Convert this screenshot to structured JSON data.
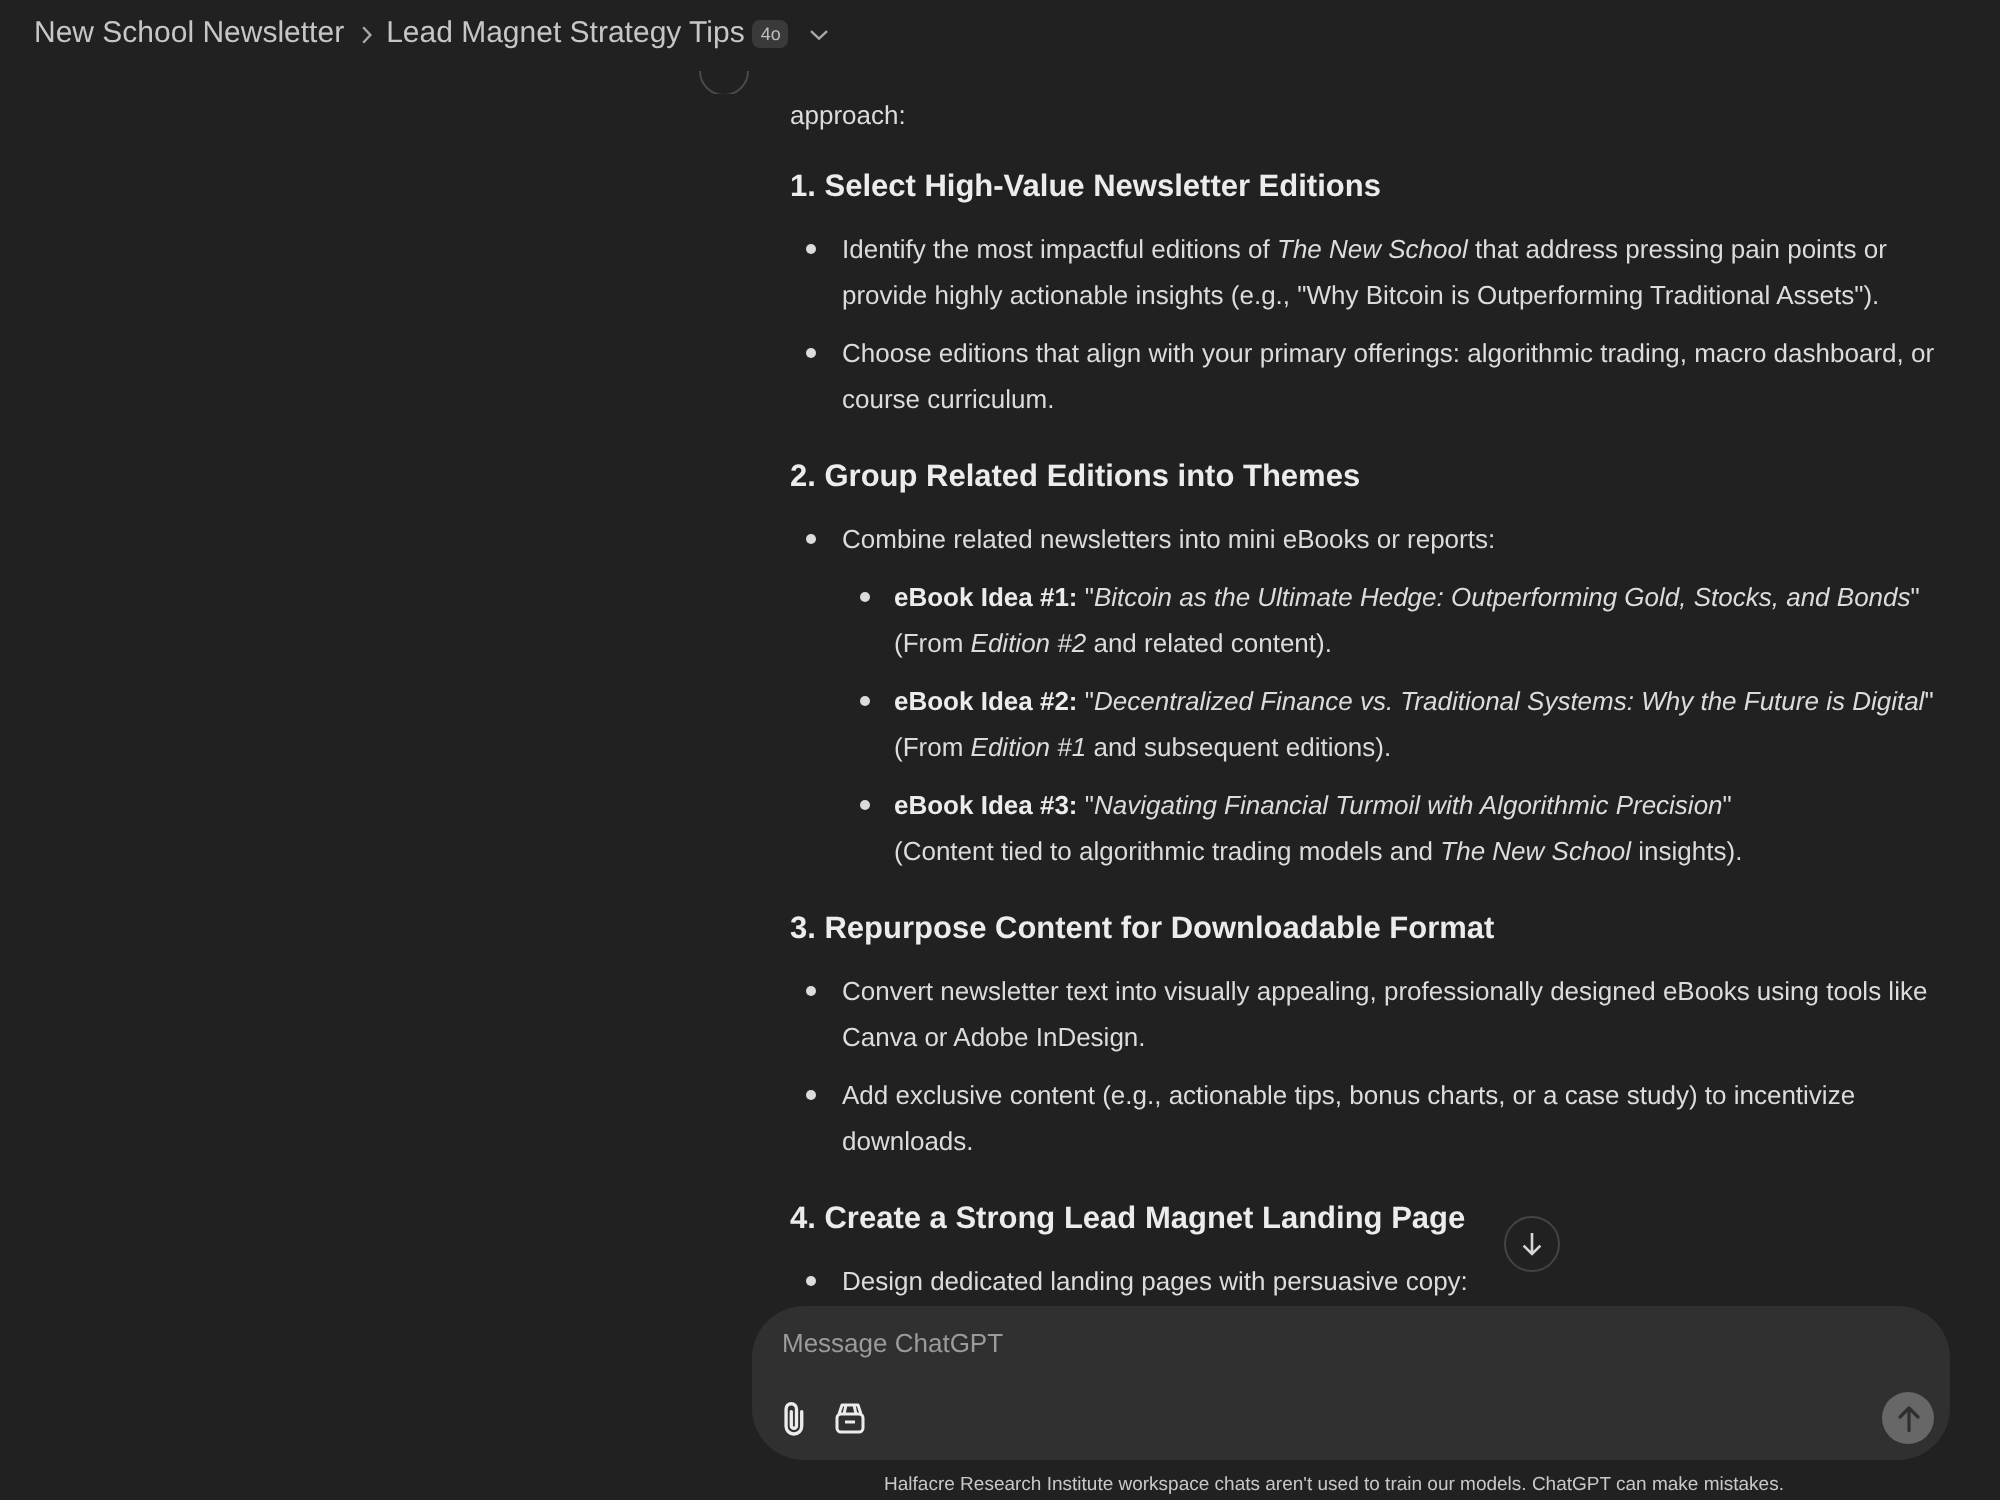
{
  "header": {
    "project": "New School Newsletter",
    "title": "Lead Magnet Strategy Tips",
    "model_badge": "4o"
  },
  "message": {
    "intro": "approach:",
    "sections": [
      {
        "heading": "1. Select High-Value Newsletter Editions",
        "bullets": [
          {
            "text": "Identify the most impactful editions of *The New School* that address pressing pain points or provide highly actionable insights (e.g., \"Why Bitcoin is Outperforming Traditional Assets\")."
          },
          {
            "text": "Choose editions that align with your primary offerings: algorithmic trading, macro dashboard, or course curriculum."
          }
        ]
      },
      {
        "heading": "2. Group Related Editions into Themes",
        "bullets": [
          {
            "text": "Combine related newsletters into mini eBooks or reports:",
            "children": [
              {
                "text": "**eBook Idea #1:** \"*Bitcoin as the Ultimate Hedge: Outperforming Gold, Stocks, and Bonds*\"",
                "note": "(From *Edition #2* and related content)."
              },
              {
                "text": "**eBook Idea #2:** \"*Decentralized Finance vs. Traditional Systems: Why the Future is Digital*\"",
                "note": "(From *Edition #1* and subsequent editions)."
              },
              {
                "text": "**eBook Idea #3:** \"*Navigating Financial Turmoil with Algorithmic Precision*\"",
                "note": "(Content tied to algorithmic trading models and *The New School* insights)."
              }
            ]
          }
        ]
      },
      {
        "heading": "3. Repurpose Content for Downloadable Format",
        "bullets": [
          {
            "text": "Convert newsletter text into visually appealing, professionally designed eBooks using tools like Canva or Adobe InDesign."
          },
          {
            "text": "Add exclusive content (e.g., actionable tips, bonus charts, or a case study) to incentivize downloads."
          }
        ]
      },
      {
        "heading": "4. Create a Strong Lead Magnet Landing Page",
        "bullets": [
          {
            "text": "Design dedicated landing pages with persuasive copy:"
          }
        ]
      }
    ]
  },
  "composer": {
    "placeholder": "Message ChatGPT",
    "send_disabled": true
  },
  "disclaimer": "Halfacre Research Institute workspace chats aren't used to train our models. ChatGPT can make mistakes."
}
